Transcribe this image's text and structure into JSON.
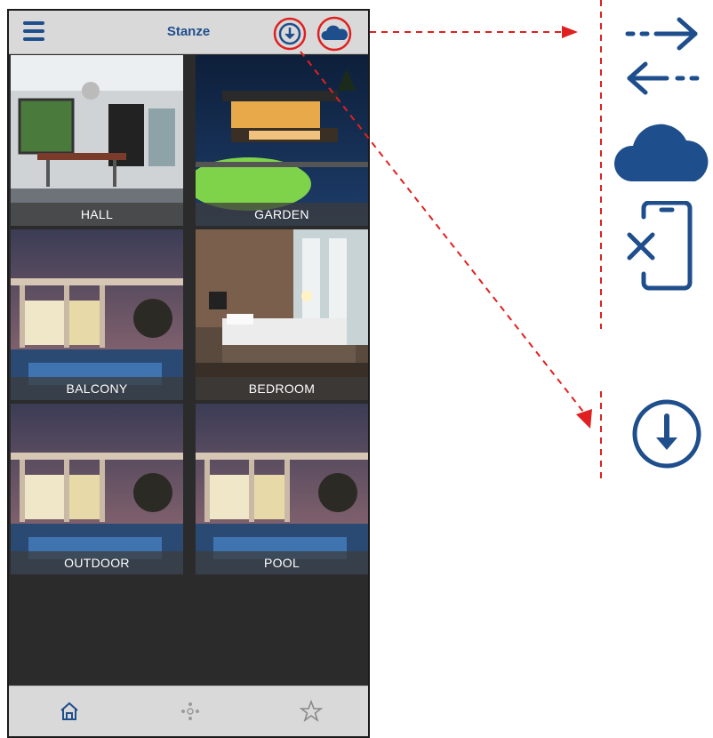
{
  "header": {
    "title": "Stanze"
  },
  "rooms": [
    {
      "label": "HALL"
    },
    {
      "label": "GARDEN"
    },
    {
      "label": "BALCONY"
    },
    {
      "label": "BEDROOM"
    },
    {
      "label": "OUTDOOR"
    },
    {
      "label": "POOL"
    }
  ],
  "icons": {
    "menu": "hamburger-menu-icon",
    "download": "download-icon",
    "cloud": "cloud-icon",
    "home": "home-icon",
    "scenes": "scenes-icon",
    "favorites": "star-icon",
    "sync": "sync-arrows-icon",
    "device_remove": "phone-remove-icon"
  },
  "colors": {
    "accent": "#1f4e8c",
    "annotation": "#e02020",
    "bar_bg": "#d9d9d9",
    "content_bg": "#2b2b2b"
  }
}
